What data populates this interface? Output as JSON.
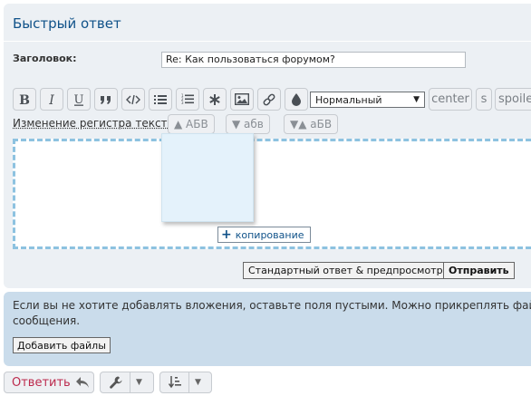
{
  "panel": {
    "title": "Быстрый ответ",
    "subject_label": "Заголовок:",
    "subject_value": "Re: Как пользоваться форумом?"
  },
  "toolbar": {
    "buttons": [
      "bold-icon",
      "italic-icon",
      "underline-icon",
      "quote-icon",
      "code-icon",
      "list-icon",
      "numbered-list-icon",
      "list-item-icon",
      "image-icon",
      "link-icon",
      "color-icon"
    ],
    "font_size": "Нормальный",
    "center_label": "center",
    "s_label": "s",
    "spoiler_label": "spoile"
  },
  "case_row": {
    "label": "Изменение регистра текста:",
    "upper": "▲ АБВ",
    "lower": "▼ абв",
    "toggle": "▼▲ аБВ"
  },
  "drag": {
    "copy_tip": "копирование"
  },
  "actions": {
    "preview_label": "Стандартный ответ & предпросмотр",
    "submit_label": "Отправить"
  },
  "attachments": {
    "line1": "Если вы не хотите добавлять вложения, оставьте поля пустыми. Можно прикреплять файл",
    "line2": "сообщения.",
    "add_files_label": "Добавить файлы"
  },
  "bottom": {
    "reply_label": "Ответить"
  },
  "colors": {
    "title": "#105289",
    "reply": "#bc2a4d",
    "panel_bg": "#ecf0f4",
    "attach_bg": "#cadceb"
  }
}
